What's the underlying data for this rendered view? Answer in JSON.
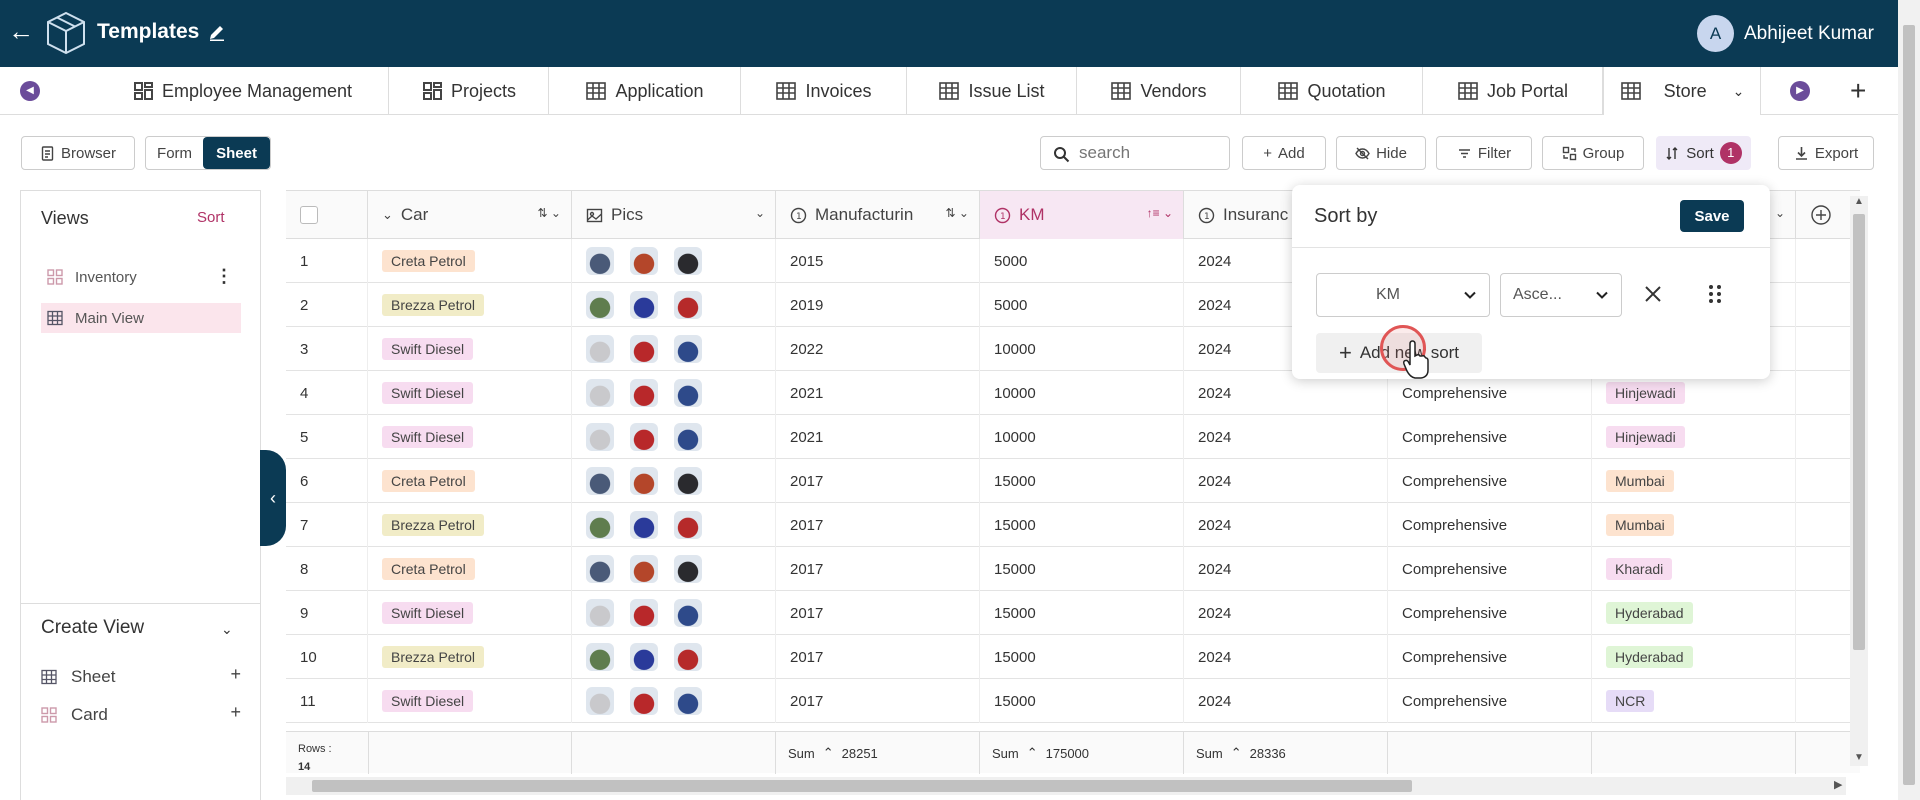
{
  "app": {
    "title": "Templates",
    "user_initial": "A",
    "user_name": "Abhijeet Kumar"
  },
  "tabs": [
    {
      "label": "Employee Management",
      "icon": "dashboard-icon"
    },
    {
      "label": "Projects",
      "icon": "dashboard-icon"
    },
    {
      "label": "Application",
      "icon": "table-icon"
    },
    {
      "label": "Invoices",
      "icon": "table-icon"
    },
    {
      "label": "Issue List",
      "icon": "table-icon"
    },
    {
      "label": "Vendors",
      "icon": "table-icon"
    },
    {
      "label": "Quotation",
      "icon": "table-icon"
    },
    {
      "label": "Job Portal",
      "icon": "table-icon"
    },
    {
      "label": "Store",
      "icon": "table-icon"
    }
  ],
  "toolbar": {
    "browser": "Browser",
    "form": "Form",
    "sheet": "Sheet",
    "search_placeholder": "search",
    "add": "Add",
    "hide": "Hide",
    "filter": "Filter",
    "group": "Group",
    "sort": "Sort",
    "sort_count": "1",
    "export": "Export"
  },
  "sidebar": {
    "views_title": "Views",
    "sort_link": "Sort",
    "views": [
      {
        "label": "Inventory"
      },
      {
        "label": "Main View"
      }
    ],
    "create_title": "Create View",
    "create_items": [
      {
        "label": "Sheet"
      },
      {
        "label": "Card"
      }
    ]
  },
  "columns": {
    "car": "Car",
    "pics": "Pics",
    "manufacturing": "Manufacturin",
    "km": "KM",
    "insurance": "Insuranc"
  },
  "rows": [
    {
      "n": "1",
      "car": "Creta Petrol",
      "year": "2015",
      "km": "5000",
      "ins": "2024",
      "type": "",
      "loc": ""
    },
    {
      "n": "2",
      "car": "Brezza Petrol",
      "year": "2019",
      "km": "5000",
      "ins": "2024",
      "type": "",
      "loc": ""
    },
    {
      "n": "3",
      "car": "Swift Diesel",
      "year": "2022",
      "km": "10000",
      "ins": "2024",
      "type": "",
      "loc": ""
    },
    {
      "n": "4",
      "car": "Swift Diesel",
      "year": "2021",
      "km": "10000",
      "ins": "2024",
      "type": "Comprehensive",
      "loc": "Hinjewadi"
    },
    {
      "n": "5",
      "car": "Swift Diesel",
      "year": "2021",
      "km": "10000",
      "ins": "2024",
      "type": "Comprehensive",
      "loc": "Hinjewadi"
    },
    {
      "n": "6",
      "car": "Creta Petrol",
      "year": "2017",
      "km": "15000",
      "ins": "2024",
      "type": "Comprehensive",
      "loc": "Mumbai"
    },
    {
      "n": "7",
      "car": "Brezza Petrol",
      "year": "2017",
      "km": "15000",
      "ins": "2024",
      "type": "Comprehensive",
      "loc": "Mumbai"
    },
    {
      "n": "8",
      "car": "Creta Petrol",
      "year": "2017",
      "km": "15000",
      "ins": "2024",
      "type": "Comprehensive",
      "loc": "Kharadi"
    },
    {
      "n": "9",
      "car": "Swift Diesel",
      "year": "2017",
      "km": "15000",
      "ins": "2024",
      "type": "Comprehensive",
      "loc": "Hyderabad"
    },
    {
      "n": "10",
      "car": "Brezza Petrol",
      "year": "2017",
      "km": "15000",
      "ins": "2024",
      "type": "Comprehensive",
      "loc": "Hyderabad"
    },
    {
      "n": "11",
      "car": "Swift Diesel",
      "year": "2017",
      "km": "15000",
      "ins": "2024",
      "type": "Comprehensive",
      "loc": "NCR"
    }
  ],
  "footer": {
    "rows_label": "Rows :",
    "rows_count": "14",
    "sum_label": "Sum",
    "sum_manufacturing": "28251",
    "sum_km": "175000",
    "sum_insurance": "28336"
  },
  "sort_popover": {
    "title": "Sort by",
    "save": "Save",
    "field": "KM",
    "direction": "Asce...",
    "add_new": "Add new sort"
  },
  "colors": {
    "brand": "#0b3a54",
    "accent": "#b03266",
    "tag_creta": "#fde3cf",
    "tag_brezza": "#f1ecc7",
    "tag_swift": "#f7dcf0",
    "loc_hinjewadi": "#f7dcf0",
    "loc_mumbai": "#fde3cf",
    "loc_kharadi": "#f7dcf0",
    "loc_hyderabad": "#dff5d6",
    "loc_ncr": "#e6dcf7"
  }
}
